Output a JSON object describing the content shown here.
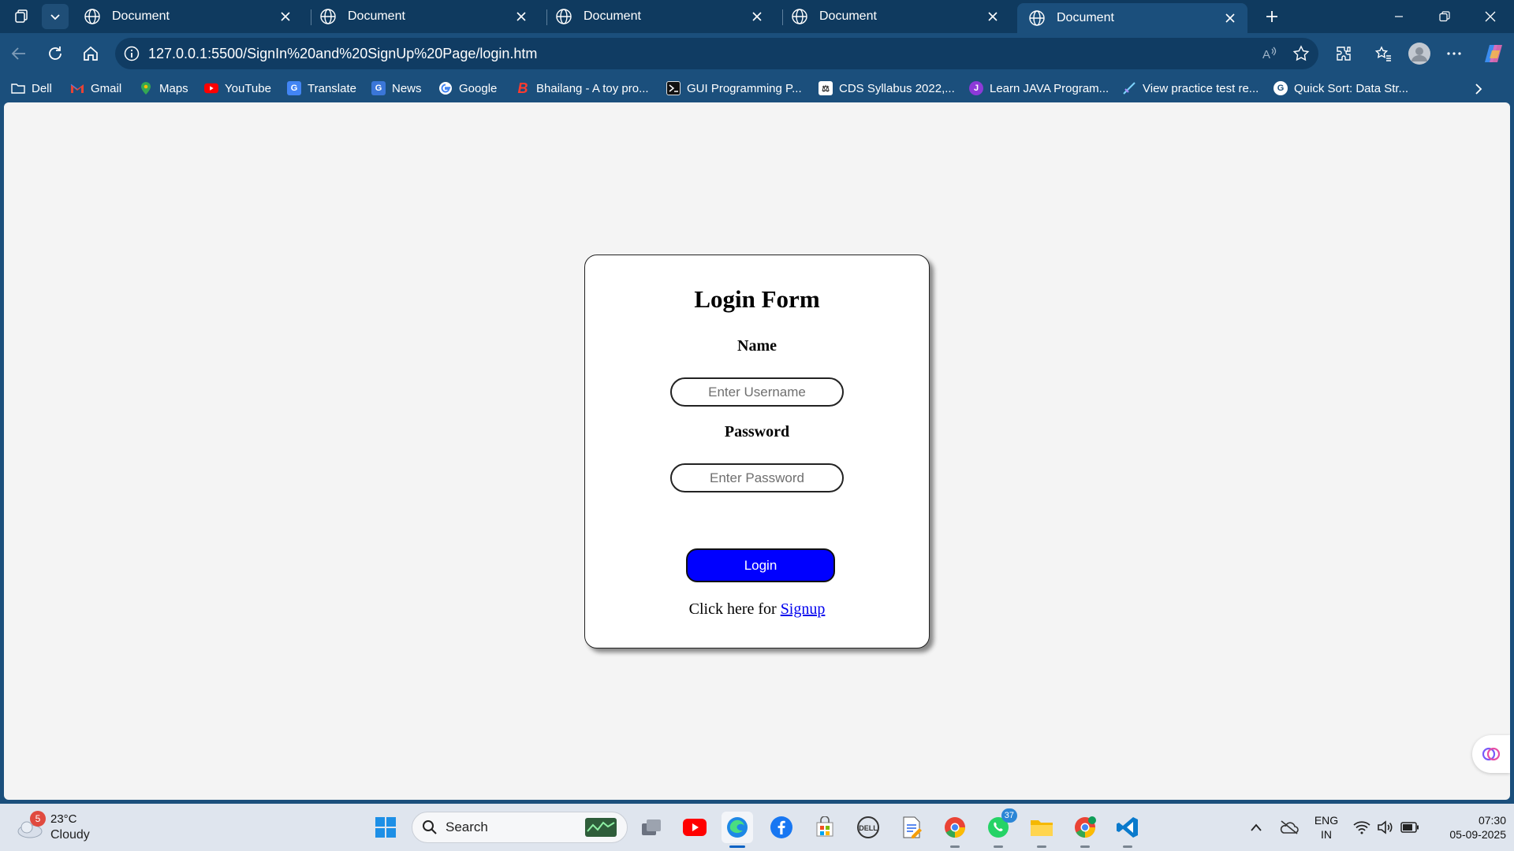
{
  "browser": {
    "tabs": [
      {
        "title": "Document",
        "active": false
      },
      {
        "title": "Document",
        "active": false
      },
      {
        "title": "Document",
        "active": false
      },
      {
        "title": "Document",
        "active": false
      },
      {
        "title": "Document",
        "active": true
      }
    ],
    "address_url": "127.0.0.1:5500/SignIn%20and%20SignUp%20Page/login.htm",
    "bookmarks": [
      {
        "label": "Dell",
        "icon": "folder-icon"
      },
      {
        "label": "Gmail",
        "icon": "gmail-icon"
      },
      {
        "label": "Maps",
        "icon": "maps-icon"
      },
      {
        "label": "YouTube",
        "icon": "youtube-icon"
      },
      {
        "label": "Translate",
        "icon": "translate-icon"
      },
      {
        "label": "News",
        "icon": "news-icon"
      },
      {
        "label": "Google",
        "icon": "google-icon"
      },
      {
        "label": "Bhailang - A toy pro...",
        "icon": "bhailang-icon"
      },
      {
        "label": "GUI Programming P...",
        "icon": "terminal-icon"
      },
      {
        "label": "CDS Syllabus 2022,...",
        "icon": "cds-icon"
      },
      {
        "label": "Learn JAVA Program...",
        "icon": "java-icon"
      },
      {
        "label": "View practice test re...",
        "icon": "practice-icon"
      },
      {
        "label": "Quick Sort: Data Str...",
        "icon": "quicksort-icon"
      }
    ]
  },
  "login": {
    "title": "Login Form",
    "name_label": "Name",
    "username_placeholder": "Enter Username",
    "password_label": "Password",
    "password_placeholder": "Enter Password",
    "button_label": "Login",
    "signup_prefix": "Click here for",
    "signup_link": "Signup"
  },
  "taskbar": {
    "weather_temp": "23°C",
    "weather_condition": "Cloudy",
    "weather_badge": "5",
    "search_label": "Search",
    "whatsapp_badge": "37",
    "language_line1": "ENG",
    "language_line2": "IN",
    "time": "07:30",
    "date": "05-09-2025"
  },
  "colors": {
    "login_button": "#0000ff",
    "link": "#0000ee",
    "browser_frame": "#1b4f7c"
  }
}
